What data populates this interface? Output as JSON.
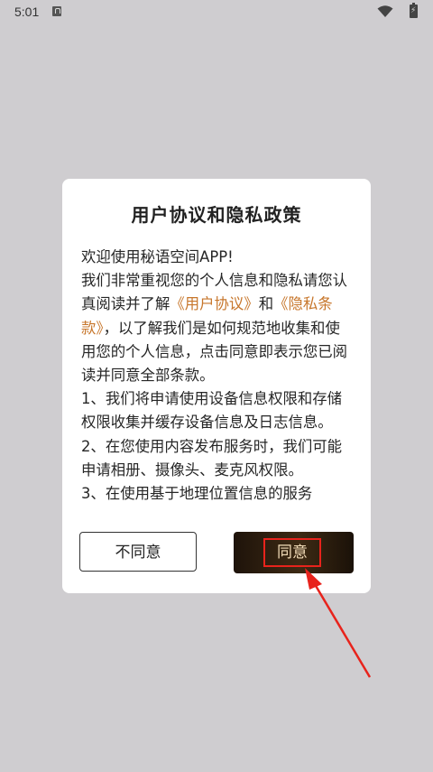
{
  "status_bar": {
    "time": "5:01",
    "battery_glyph": "⚡"
  },
  "dialog": {
    "title": "用户协议和隐私政策",
    "body": {
      "greeting": "欢迎使用秘语空间APP!",
      "line_intro": "我们非常重视您的个人信息和隐私请您认真阅读并了解",
      "link_user_agreement": "《用户协议》",
      "and": "和",
      "link_privacy_terms": "《隐私条款》",
      "line_after_links": "，以了解我们是如何规范地收集和使用您的个人信息，点击同意即表示您已阅读并同意全部条款。",
      "item1": "1、我们将申请使用设备信息权限和存储权限收集并缓存设备信息及日志信息。",
      "item2": "2、在您使用内容发布服务时，我们可能申请相册、摄像头、麦克风权限。",
      "item3": "3、在使用基于地理位置信息的服务"
    },
    "disagree_label": "不同意",
    "agree_label": "同意"
  },
  "colors": {
    "link": "#c7762b",
    "annotation": "#e8231c"
  }
}
